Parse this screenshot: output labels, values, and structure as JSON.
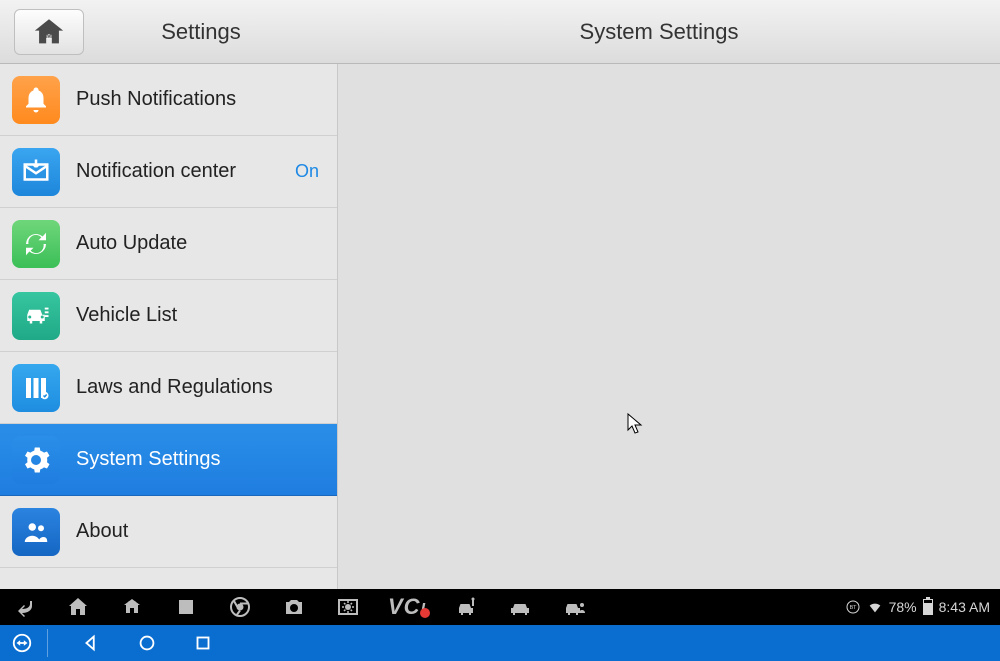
{
  "header": {
    "left_title": "Settings",
    "right_title": "System Settings"
  },
  "sidebar": {
    "items": [
      {
        "label": "Push Notifications",
        "status": ""
      },
      {
        "label": "Notification center",
        "status": "On"
      },
      {
        "label": "Auto Update",
        "status": ""
      },
      {
        "label": "Vehicle List",
        "status": ""
      },
      {
        "label": "Laws and Regulations",
        "status": ""
      },
      {
        "label": "System Settings",
        "status": ""
      },
      {
        "label": "About",
        "status": ""
      }
    ],
    "selected_index": 5
  },
  "statusbar": {
    "vci_label": "VC",
    "battery_percent": "78%",
    "time": "8:43 AM"
  }
}
